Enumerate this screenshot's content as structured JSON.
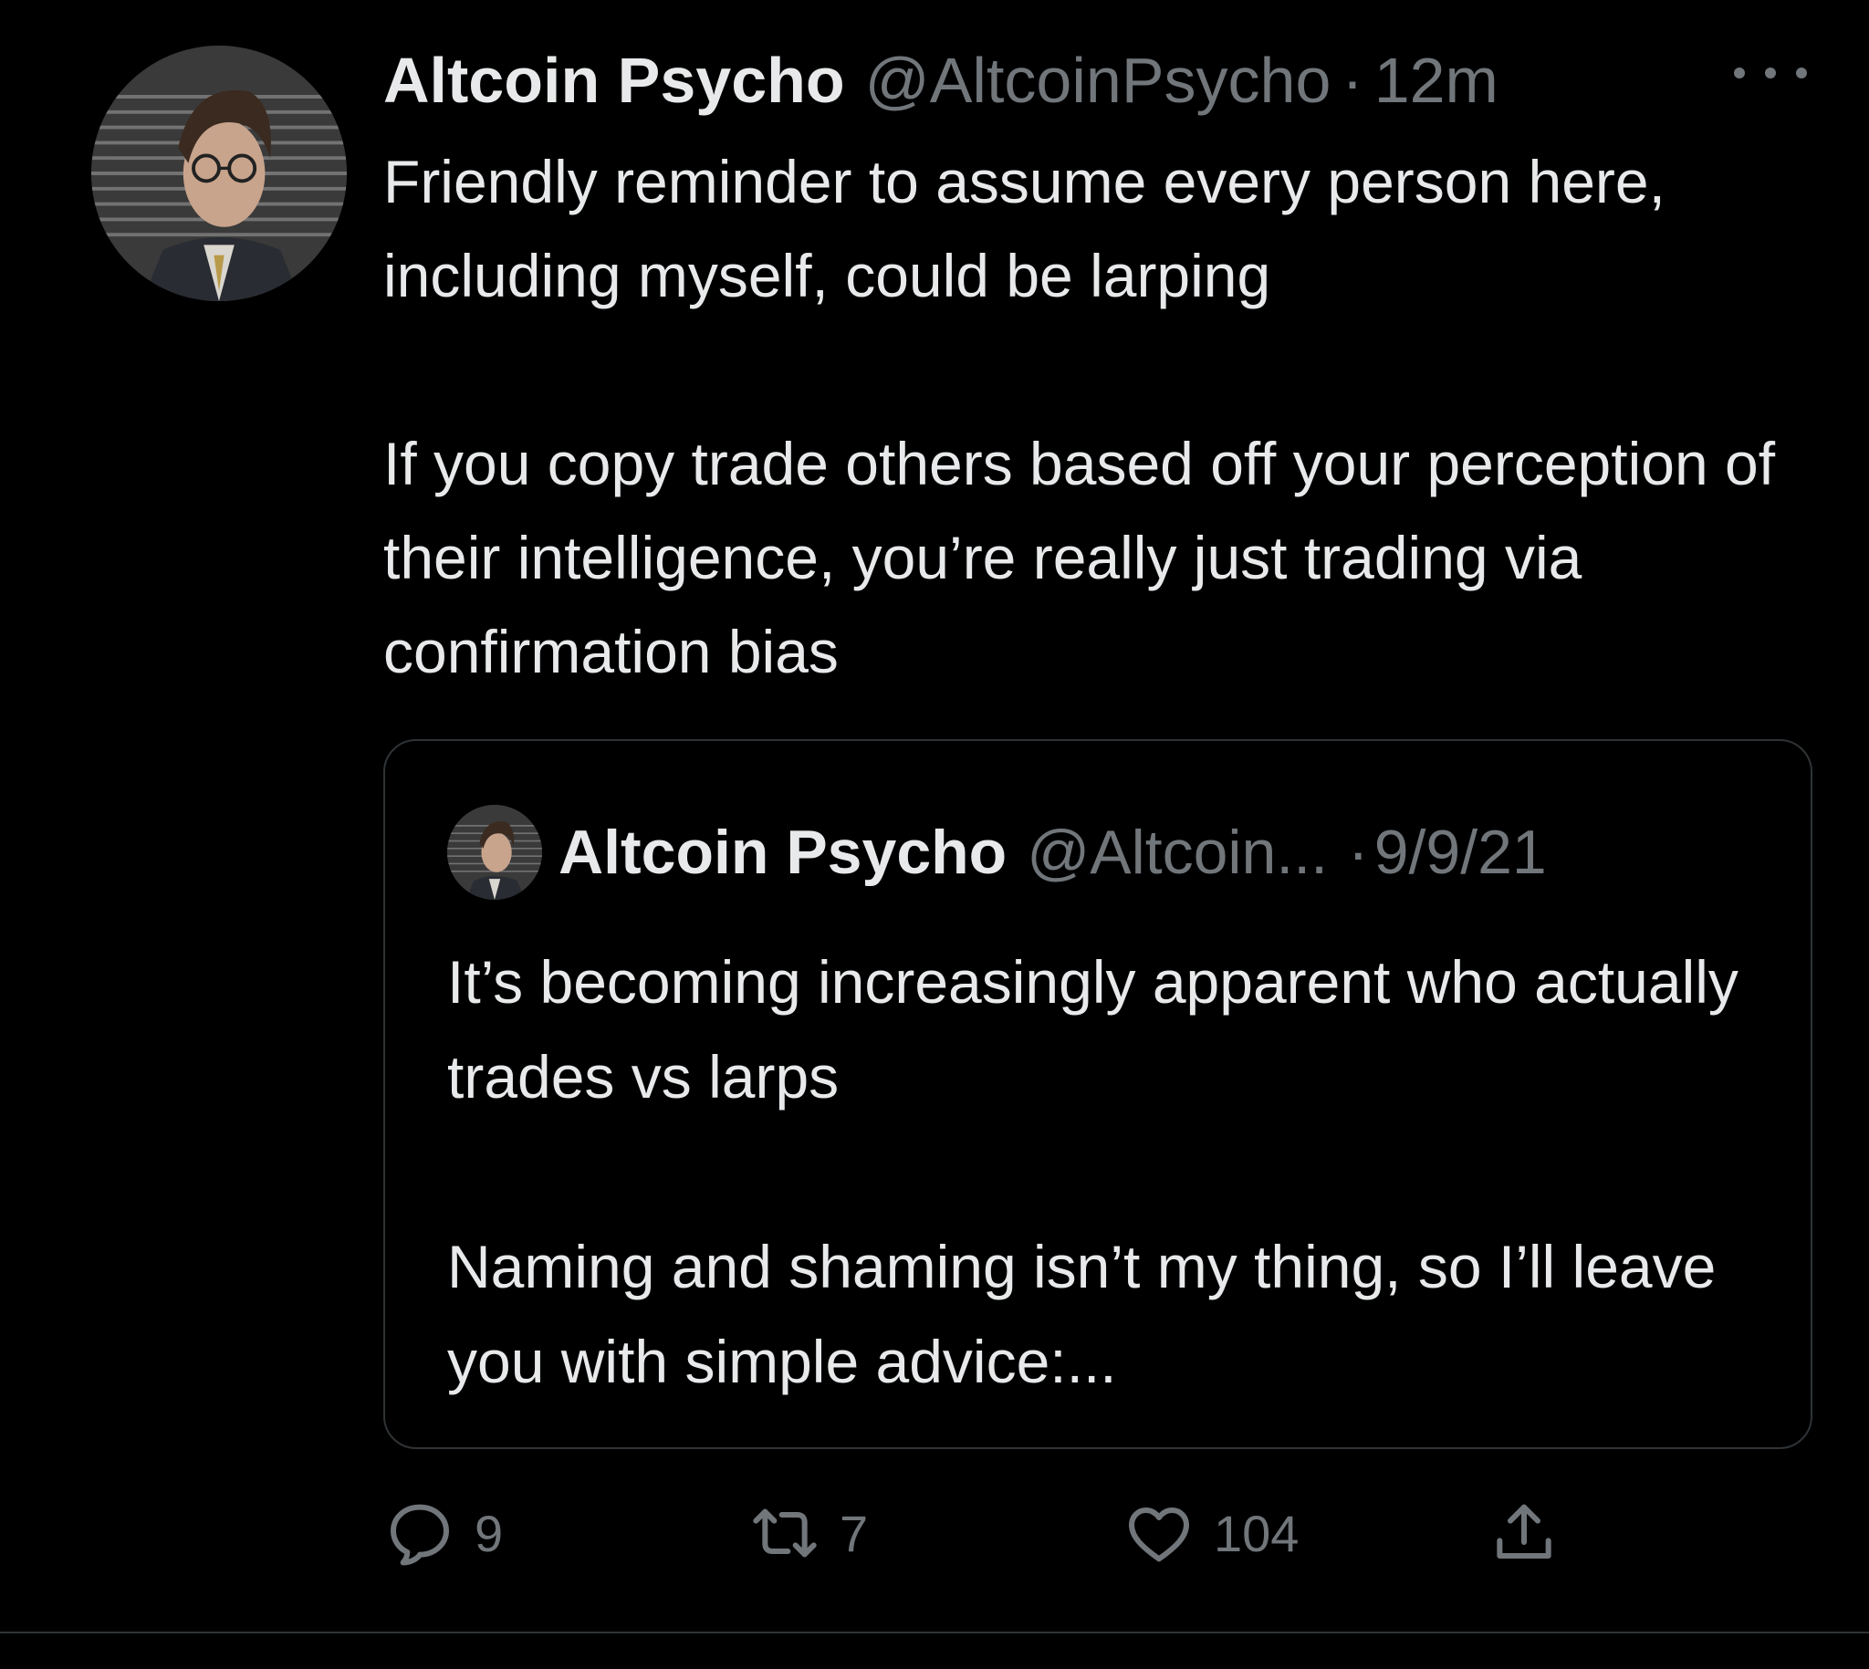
{
  "tweet": {
    "author": {
      "display_name": "Altcoin Psycho",
      "handle": "@AltcoinPsycho",
      "avatar_icon": "profile-photo-man-glasses"
    },
    "separator": "·",
    "time": "12m",
    "more_icon": "more-horizontal-icon",
    "text": "Friendly reminder to assume every person here, including myself, could be larping\n\nIf you copy trade others based off your perception of their intelligence, you’re really just trading via confirmation bias",
    "quoted": {
      "display_name": "Altcoin Psycho",
      "handle": "@Altcoin...",
      "separator": "·",
      "date": "9/9/21",
      "text": "It’s becoming increasingly apparent who actually trades vs larps\n\nNaming and shaming isn’t my thing, so I’ll leave you with simple advice:..."
    },
    "actions": {
      "reply": {
        "icon": "reply-icon",
        "count": "9"
      },
      "retweet": {
        "icon": "retweet-icon",
        "count": "7"
      },
      "like": {
        "icon": "heart-icon",
        "count": "104"
      },
      "share": {
        "icon": "share-icon"
      }
    }
  },
  "colors": {
    "background": "#000000",
    "primary_text": "#e7e9ea",
    "secondary_text": "#71767b",
    "border": "#2f3336"
  }
}
